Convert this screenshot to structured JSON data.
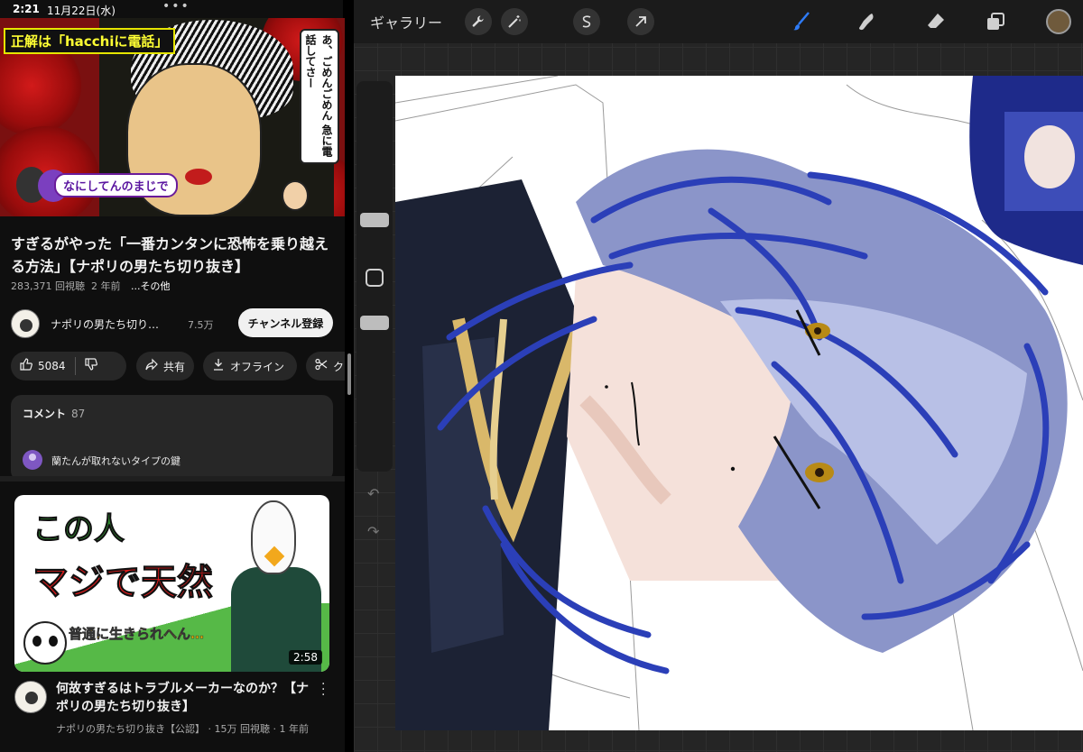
{
  "status": {
    "time": "2:21",
    "date": "11月22日(水)",
    "dots": "•••"
  },
  "video1": {
    "banner": "正解は「hacchiに電話」",
    "bubble": "あ、ごめんごめん 急に電話してさー",
    "caption": "なにしてんのまじで",
    "title": "すぎるがやった「一番カンタンに恐怖を乗り越える方法」【ナポリの男たち切り抜き】",
    "views": "283,371 回視聴",
    "age": "2 年前",
    "more": "...その他"
  },
  "channel": {
    "name": "ナポリの男たち切り…",
    "subs": "7.5万",
    "subscribe": "チャンネル登録"
  },
  "actions": {
    "likes": "5084",
    "share": "共有",
    "offline": "オフライン",
    "clip": "ク"
  },
  "comments": {
    "header": "コメント",
    "count": "87",
    "text": "蘭たんが取れないタイプの鍵"
  },
  "video2": {
    "thumb_line1": "この人",
    "thumb_line2": "マジで天然",
    "thumb_line3": "普通に生きられへん…",
    "duration": "2:58",
    "title": "何故すぎるはトラブルメーカーなのか？【ナポリの男たち切り抜き】",
    "meta": "ナポリの男たち切り抜き【公認】 · 15万 回視聴 · 1 年前"
  },
  "procreate": {
    "gallery": "ギャラリー",
    "icons": [
      "wrench-icon",
      "magic-wand-icon",
      "selection-icon",
      "move-arrow-icon",
      "brush-icon",
      "smudge-icon",
      "eraser-icon",
      "layers-icon"
    ],
    "current_color": "#6f5a3c",
    "accent": "#2e7bf6",
    "hair_color": "#2b3fb8"
  }
}
